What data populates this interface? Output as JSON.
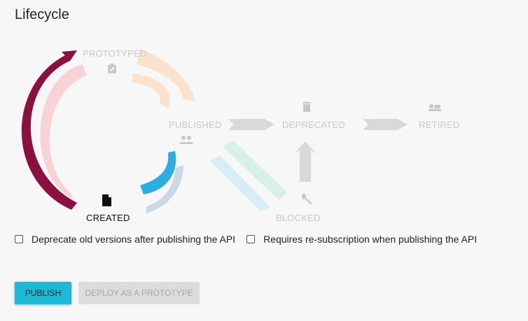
{
  "title": "Lifecycle",
  "states": {
    "prototyped": "PROTOTYPED",
    "published": "PUBLISHED",
    "deprecated": "DEPRECATED",
    "retired": "RETIRED",
    "created": "CREATED",
    "blocked": "BLOCKED"
  },
  "current_state": "CREATED",
  "icons": {
    "prototyped": "clipboard-check-icon",
    "published": "people-icon",
    "deprecated": "trash-icon",
    "retired": "retired-icon",
    "created": "document-icon",
    "blocked": "wrench-icon"
  },
  "colors": {
    "created_to_prototyped": "#8b1040",
    "prototyped_to_created": "#f7d3d6",
    "prototyped_to_published": "#fbe2cc",
    "created_to_published": "#2eaee0",
    "published_to_created": "#c9d8e4",
    "published_to_blocked": "#d7f1e6",
    "blocked_to_published": "#d5eef4",
    "inactive_arrow": "#d9d9d9",
    "publish_button": "#1eb9d4"
  },
  "options": {
    "deprecate_old": {
      "label": "Deprecate old versions after publishing the API",
      "checked": false
    },
    "resubscription": {
      "label": "Requires re-subscription when publishing the API",
      "checked": false
    }
  },
  "buttons": {
    "publish": "PUBLISH",
    "deploy_prototype": "DEPLOY AS A PROTOTYPE"
  }
}
